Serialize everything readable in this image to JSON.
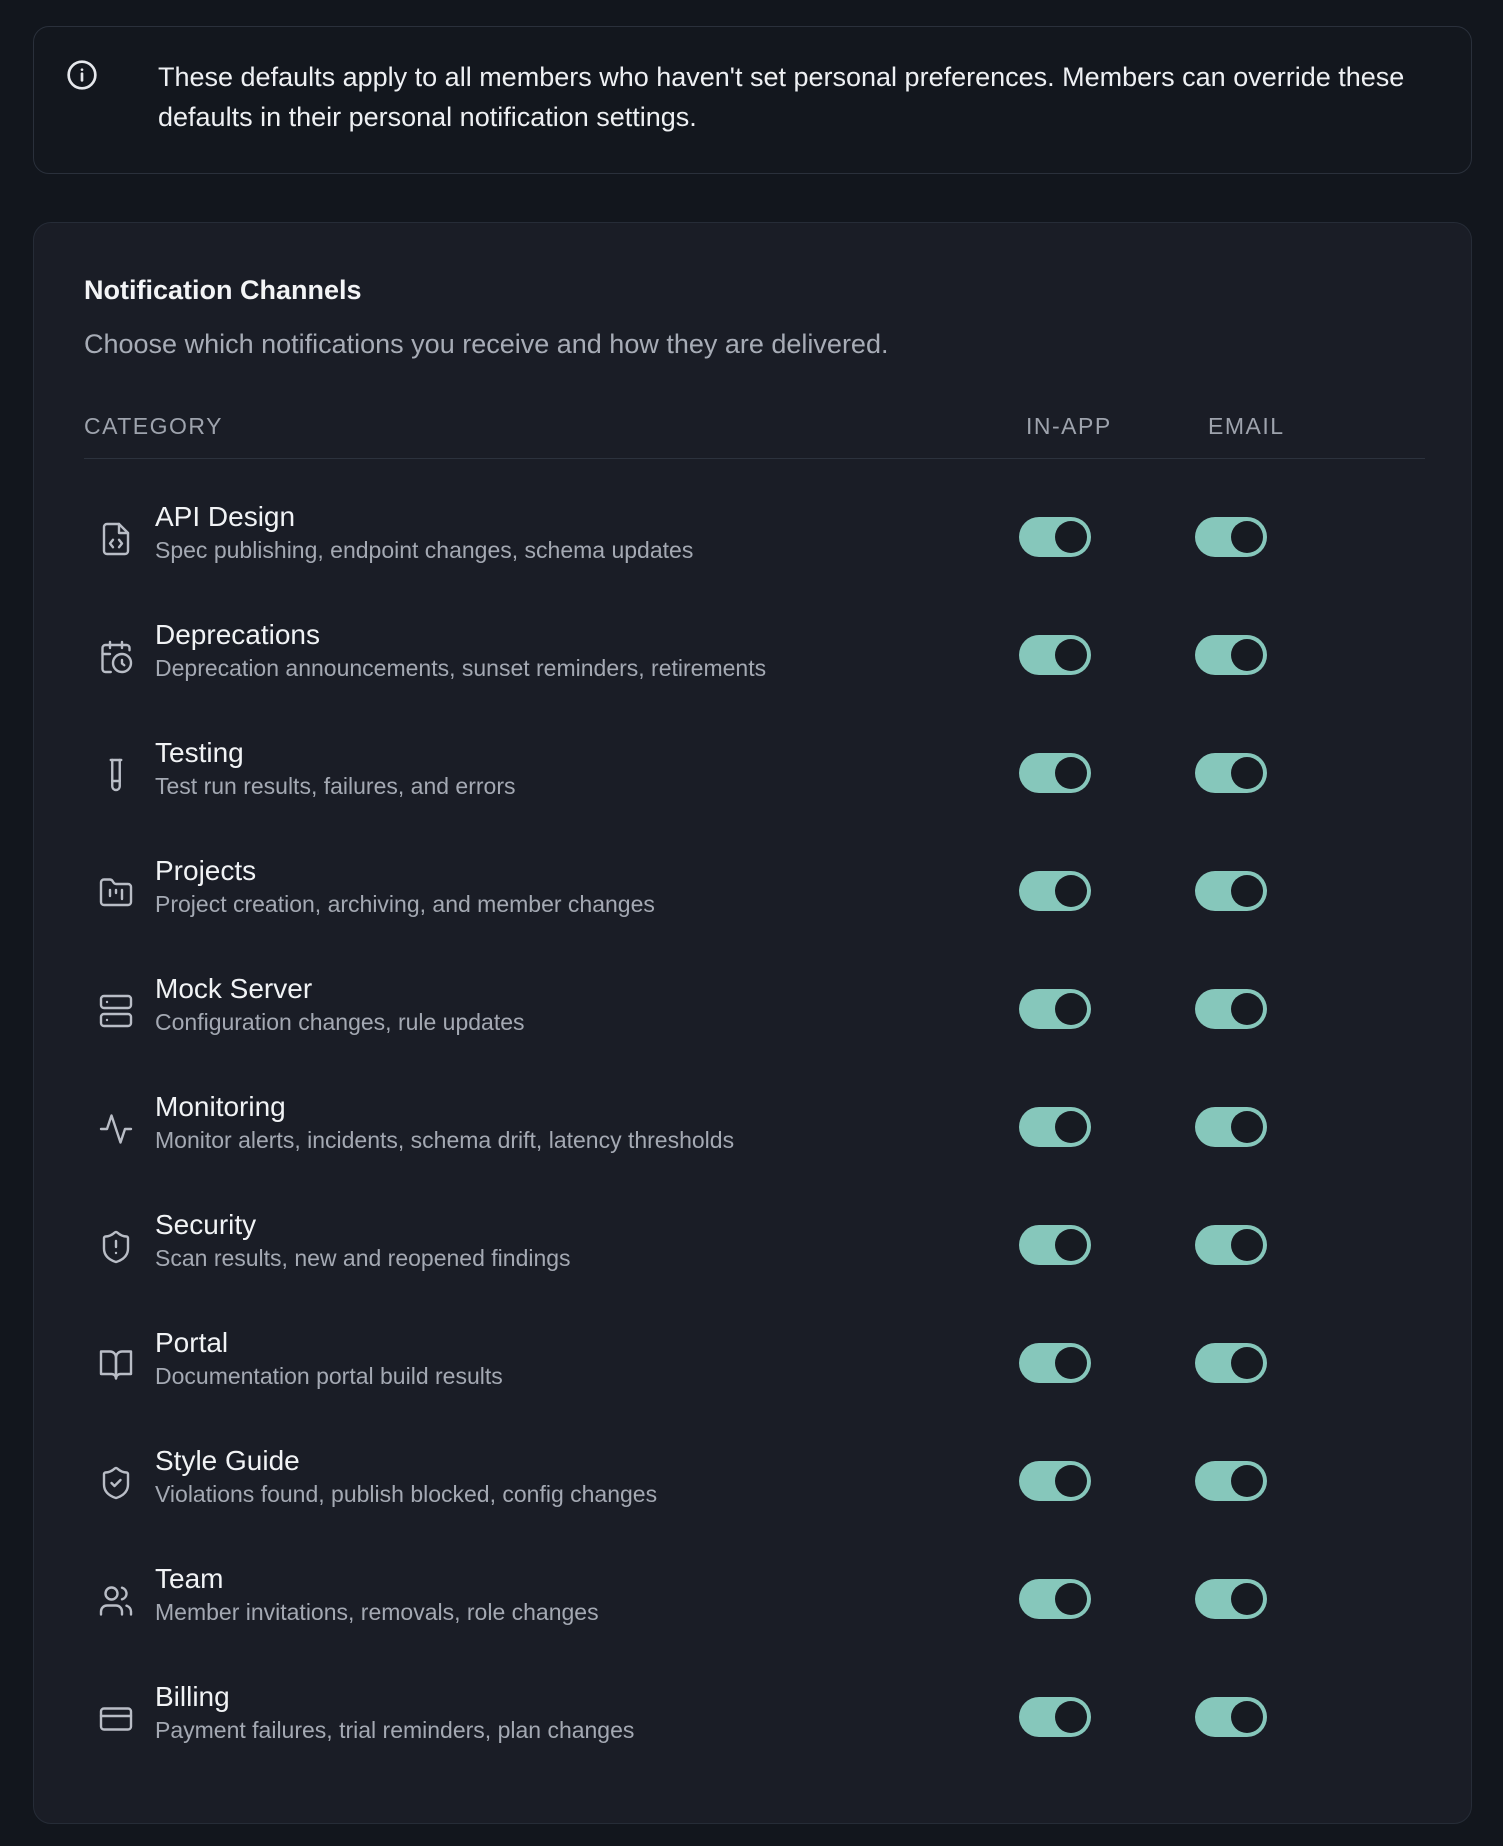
{
  "info": {
    "icon": "info-icon",
    "text": "These defaults apply to all members who haven't set personal preferences. Members can override these defaults in their personal notification settings."
  },
  "card": {
    "title": "Notification Channels",
    "subtitle": "Choose which notifications you receive and how they are delivered.",
    "headers": {
      "category": "CATEGORY",
      "in_app": "IN-APP",
      "email": "EMAIL"
    }
  },
  "colors": {
    "toggle_on": "#86c7bb",
    "background": "#12161d",
    "card": "#1a1d26"
  },
  "rows": [
    {
      "name": "API Design",
      "desc": "Spec publishing, endpoint changes, schema updates",
      "icon": "file-code-icon",
      "in_app": true,
      "email": true
    },
    {
      "name": "Deprecations",
      "desc": "Deprecation announcements, sunset reminders, retirements",
      "icon": "calendar-clock-icon",
      "in_app": true,
      "email": true
    },
    {
      "name": "Testing",
      "desc": "Test run results, failures, and errors",
      "icon": "test-tube-icon",
      "in_app": true,
      "email": true
    },
    {
      "name": "Projects",
      "desc": "Project creation, archiving, and member changes",
      "icon": "folder-kanban-icon",
      "in_app": true,
      "email": true
    },
    {
      "name": "Mock Server",
      "desc": "Configuration changes, rule updates",
      "icon": "server-icon",
      "in_app": true,
      "email": true
    },
    {
      "name": "Monitoring",
      "desc": "Monitor alerts, incidents, schema drift, latency thresholds",
      "icon": "activity-icon",
      "in_app": true,
      "email": true
    },
    {
      "name": "Security",
      "desc": "Scan results, new and reopened findings",
      "icon": "shield-alert-icon",
      "in_app": true,
      "email": true
    },
    {
      "name": "Portal",
      "desc": "Documentation portal build results",
      "icon": "book-open-icon",
      "in_app": true,
      "email": true
    },
    {
      "name": "Style Guide",
      "desc": "Violations found, publish blocked, config changes",
      "icon": "shield-check-icon",
      "in_app": true,
      "email": true
    },
    {
      "name": "Team",
      "desc": "Member invitations, removals, role changes",
      "icon": "users-icon",
      "in_app": true,
      "email": true
    },
    {
      "name": "Billing",
      "desc": "Payment failures, trial reminders, plan changes",
      "icon": "credit-card-icon",
      "in_app": true,
      "email": true
    }
  ]
}
